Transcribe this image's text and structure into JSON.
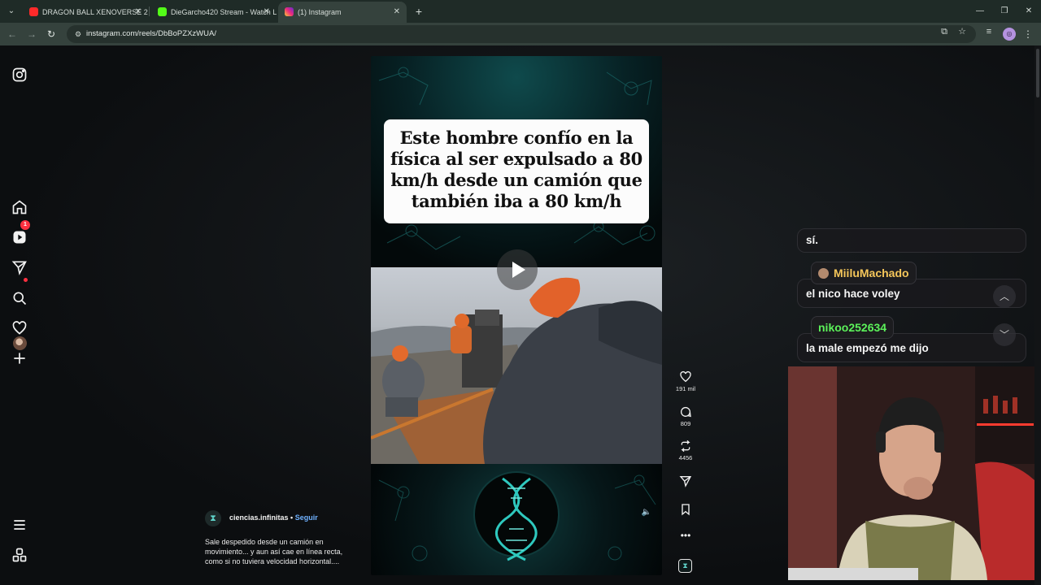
{
  "browser": {
    "tabs": [
      {
        "title": "DRAGON BALL XENOVERSE 2 -",
        "favicon_color": "#ff2a2a",
        "active": false
      },
      {
        "title": "DieGarcho420 Stream - Watch L",
        "favicon_color": "#53fc18",
        "active": false
      },
      {
        "title": "(1) Instagram",
        "favicon_color": "#e4405f",
        "active": true
      }
    ],
    "url": "instagram.com/reels/DbBoPZXzWUA/"
  },
  "sidebar": {
    "items": [
      {
        "name": "instagram-logo-icon"
      },
      {
        "name": "home-icon"
      },
      {
        "name": "reels-icon"
      },
      {
        "name": "messages-icon",
        "badge": "1"
      },
      {
        "name": "search-icon"
      },
      {
        "name": "notifications-icon"
      },
      {
        "name": "create-icon"
      },
      {
        "name": "profile-avatar"
      },
      {
        "name": "more-menu-icon"
      },
      {
        "name": "also-from-meta-icon"
      }
    ]
  },
  "reel": {
    "headline": "Este hombre confío en la física al ser expulsado a 80 km/h desde un camión que también iba a 80 km/h",
    "author": "ciencias.infinitas",
    "separator": "•",
    "follow_label": "Seguir",
    "caption": "Sale despedido desde un camión en movimiento... y aun así cae en línea recta, como si no tuviera velocidad horizontal...."
  },
  "actions": {
    "likes": "191 mil",
    "comments": "809",
    "reposts": "4456"
  },
  "stream_overlay": {
    "chat": [
      {
        "user": "",
        "text": "sí."
      },
      {
        "user": "MiiluMachado",
        "user_color": "#f5c65a",
        "text": "el nico hace voley"
      },
      {
        "user": "nikoo252634",
        "user_color": "#5cf25a",
        "text": "la male empezó me dijo"
      }
    ]
  }
}
